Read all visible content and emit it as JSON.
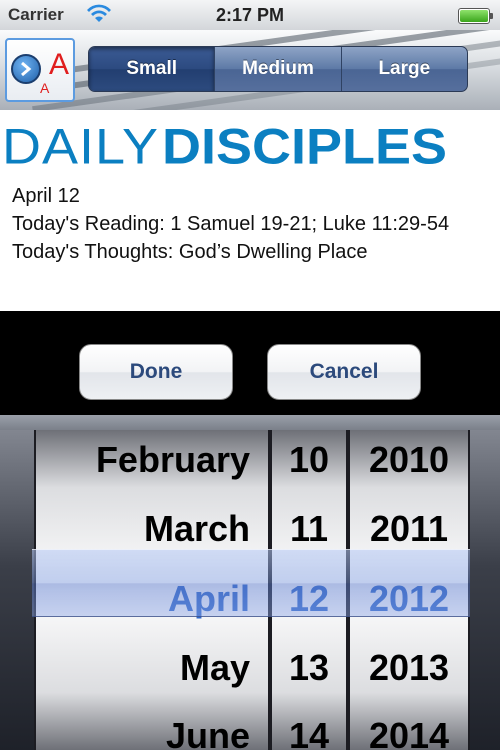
{
  "status_bar": {
    "carrier": "Carrier",
    "time": "2:17 PM",
    "signal_icon": "wifi-icon",
    "battery_icon": "battery-icon"
  },
  "toolbar": {
    "font_button_icon": "font-size-icon",
    "font_big_letter": "A",
    "font_small_letter": "A",
    "segments": [
      {
        "label": "Small",
        "selected": true
      },
      {
        "label": "Medium",
        "selected": false
      },
      {
        "label": "Large",
        "selected": false
      }
    ]
  },
  "logo": {
    "part1": "DAILY",
    "part2": "DISCIPLES",
    "color": "#0b7fc1"
  },
  "devotional": {
    "date": "April 12",
    "reading": "Today's Reading:  1 Samuel 19-21; Luke 11:29-54",
    "thoughts": "Today's Thoughts: God’s Dwelling Place"
  },
  "actions": {
    "done_label": "Done",
    "cancel_label": "Cancel"
  },
  "date_picker": {
    "months": [
      "February",
      "March",
      "April",
      "May",
      "June"
    ],
    "days": [
      "10",
      "11",
      "12",
      "13",
      "14"
    ],
    "years": [
      "2010",
      "2011",
      "2012",
      "2013",
      "2014"
    ],
    "selected": {
      "month": "April",
      "day": "12",
      "year": "2012"
    },
    "selection_color": "#2f67c9"
  }
}
